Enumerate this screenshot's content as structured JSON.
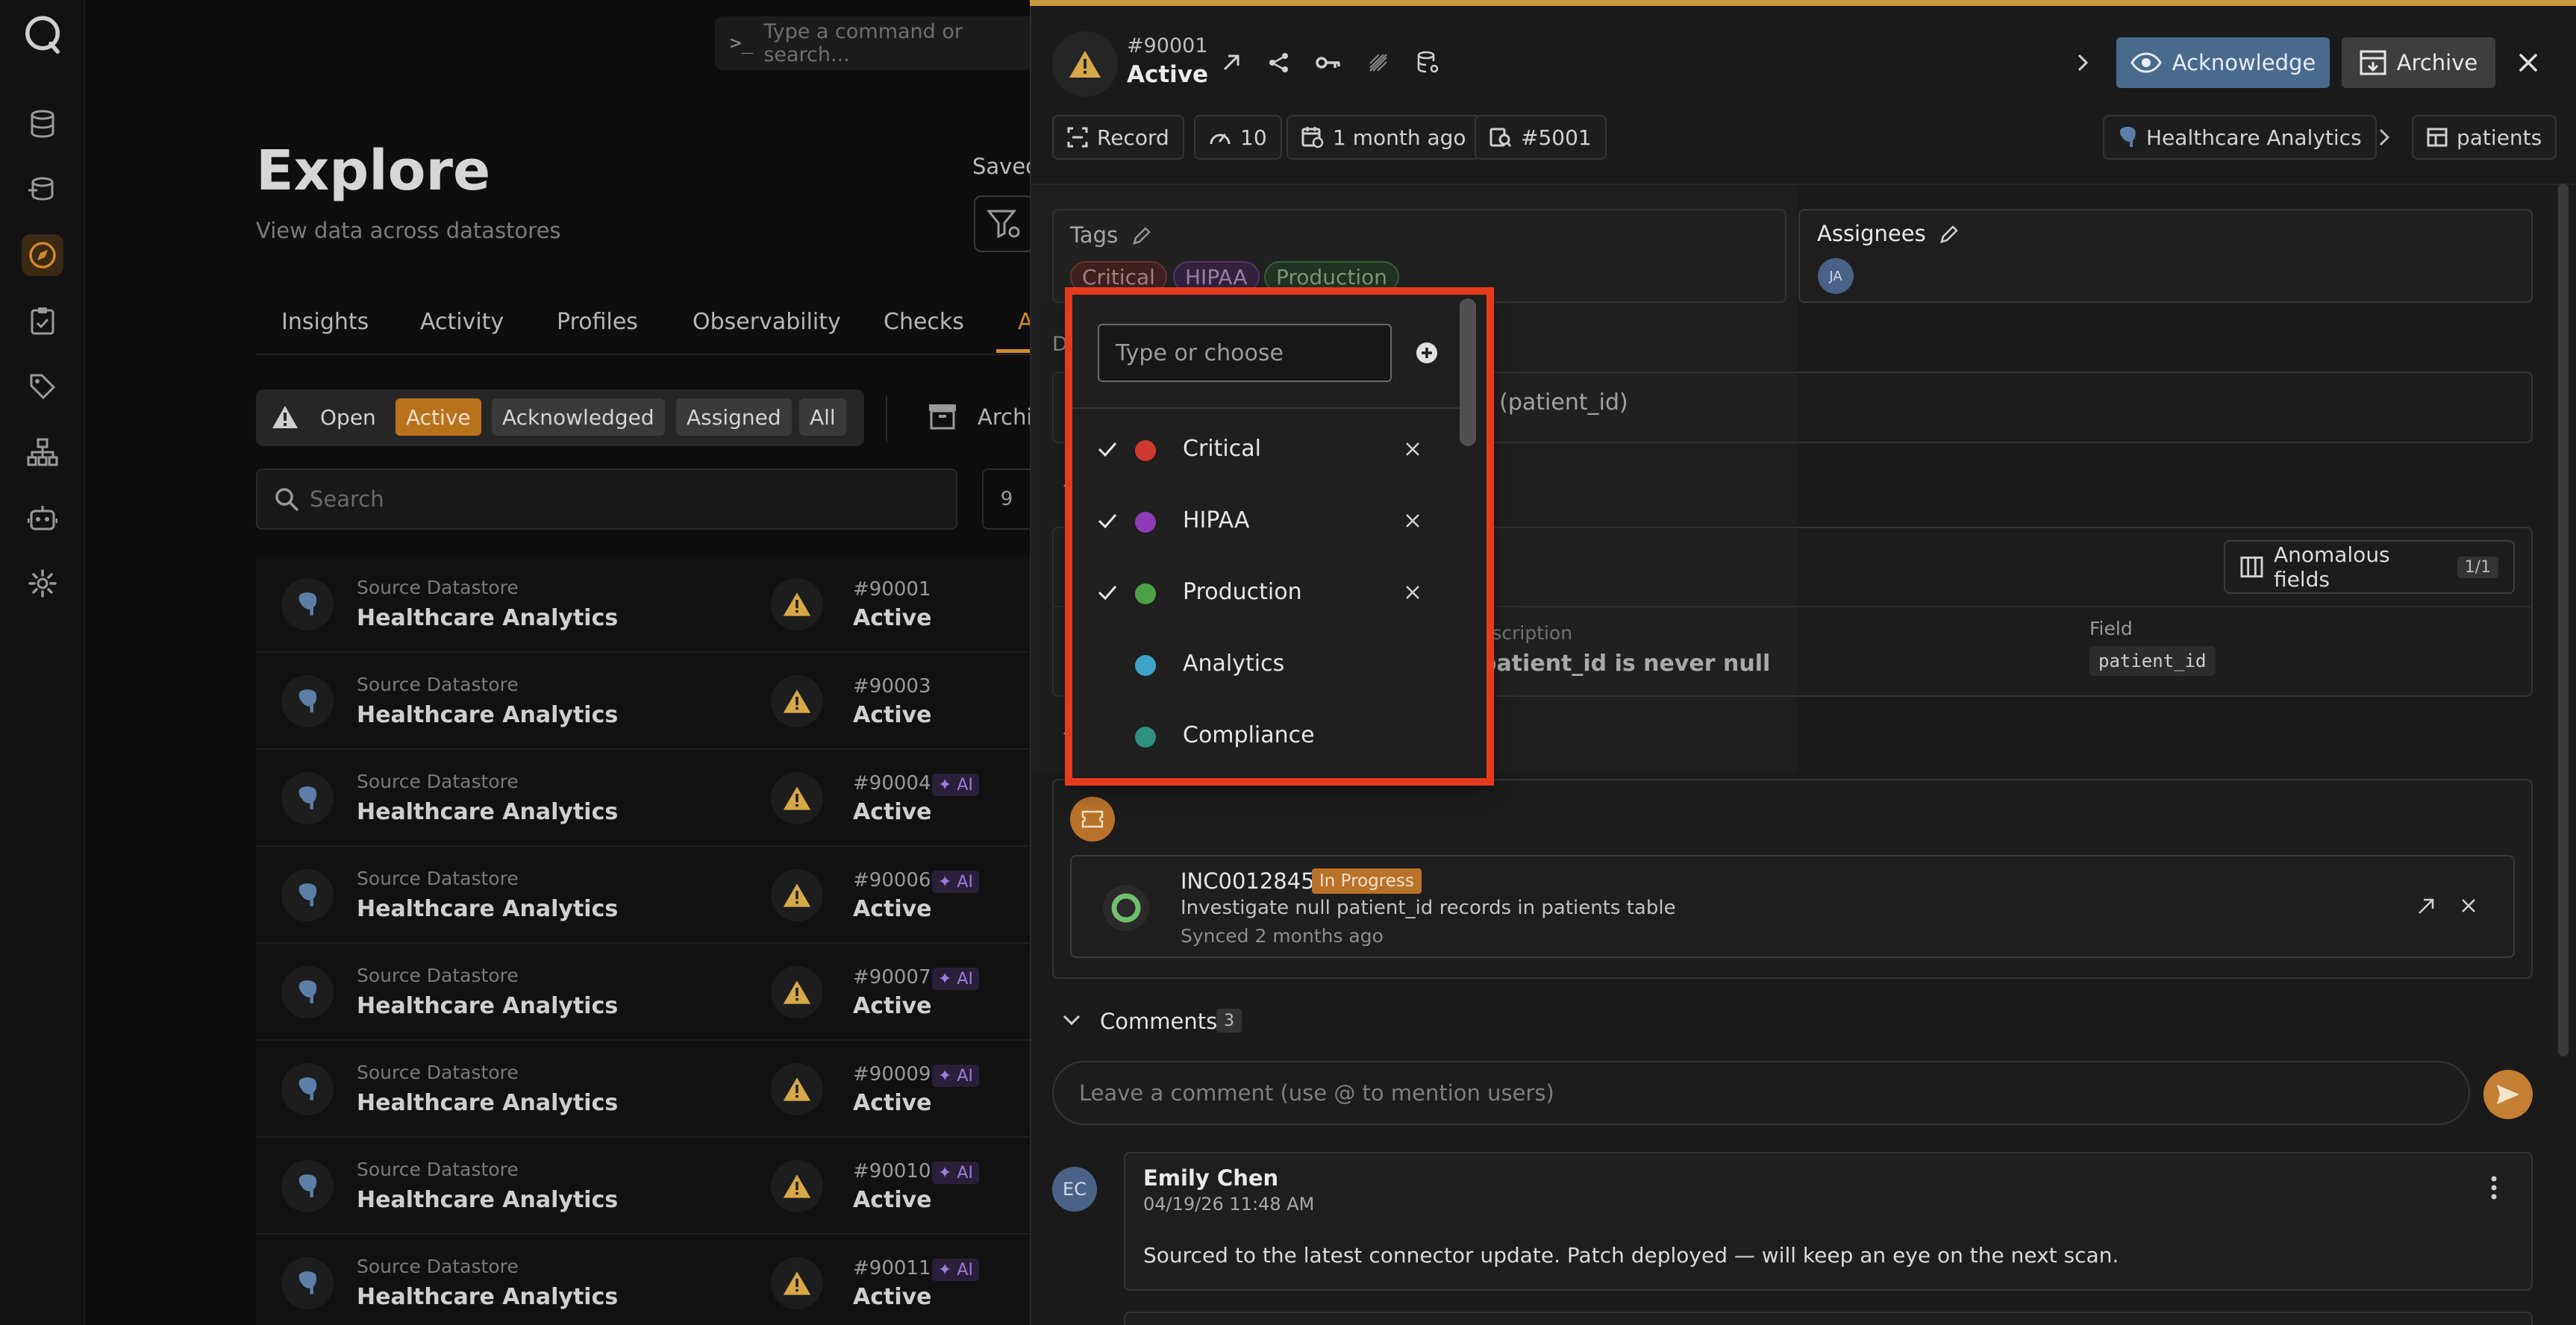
{
  "command_bar": {
    "placeholder": "Type a command or search..."
  },
  "explore": {
    "title": "Explore",
    "subtitle": "View data across datastores",
    "saved_label": "Saved",
    "tabs": [
      "Insights",
      "Activity",
      "Profiles",
      "Observability",
      "Checks",
      "A"
    ],
    "status_filters": [
      "Open",
      "Active",
      "Acknowledged",
      "Assigned",
      "All"
    ],
    "archived_label": "Archi",
    "search_placeholder": "Search",
    "view_toggle": "9",
    "rows": [
      {
        "type": "Source Datastore",
        "name": "Healthcare Analytics",
        "id": "#90001",
        "status": "Active",
        "ai": false
      },
      {
        "type": "Source Datastore",
        "name": "Healthcare Analytics",
        "id": "#90003",
        "status": "Active",
        "ai": false
      },
      {
        "type": "Source Datastore",
        "name": "Healthcare Analytics",
        "id": "#90004",
        "status": "Active",
        "ai": true
      },
      {
        "type": "Source Datastore",
        "name": "Healthcare Analytics",
        "id": "#90006",
        "status": "Active",
        "ai": true
      },
      {
        "type": "Source Datastore",
        "name": "Healthcare Analytics",
        "id": "#90007",
        "status": "Active",
        "ai": true
      },
      {
        "type": "Source Datastore",
        "name": "Healthcare Analytics",
        "id": "#90009",
        "status": "Active",
        "ai": true
      },
      {
        "type": "Source Datastore",
        "name": "Healthcare Analytics",
        "id": "#90010",
        "status": "Active",
        "ai": true
      },
      {
        "type": "Source Datastore",
        "name": "Healthcare Analytics",
        "id": "#90011",
        "status": "Active",
        "ai": true
      }
    ],
    "ai_label": "✦ AI"
  },
  "drawer": {
    "id": "#90001",
    "status": "Active",
    "acknowledge_label": "Acknowledge",
    "archive_label": "Archive",
    "meta": {
      "type": "Record",
      "weight": "10",
      "age": "1 month ago",
      "ref": "#5001",
      "datastore": "Healthcare Analytics",
      "container": "patients"
    },
    "tags_title": "Tags",
    "tags": [
      "Critical",
      "HIPAA",
      "Production"
    ],
    "assignees_title": "Assignees",
    "assignee_initials": "JA",
    "description_label": "D",
    "description_text": "s (patient_id)",
    "anomalous_fields_label": "Anomalous fields",
    "anomalous_fields_count": "1/1",
    "desc_col_label": "escription",
    "desc_col_value": "patient_id is never null",
    "field_col_label": "Field",
    "field_col_value": "patient_id",
    "ticket": {
      "number": "INC0012845",
      "status": "In Progress",
      "description": "Investigate null patient_id records in patients table",
      "synced": "Synced 2 months ago"
    },
    "comments_title": "Comments",
    "comments_count": "3",
    "comment_placeholder": "Leave a comment (use @ to mention users)",
    "comment": {
      "initials": "EC",
      "author": "Emily Chen",
      "date": "04/19/26 11:48 AM",
      "body": "Sourced to the latest connector update. Patch deployed — will keep an eye on the next scan."
    }
  },
  "tag_dropdown": {
    "placeholder": "Type or choose",
    "options": [
      {
        "label": "Critical",
        "color": "#d0392f",
        "selected": true
      },
      {
        "label": "HIPAA",
        "color": "#8e3bb8",
        "selected": true
      },
      {
        "label": "Production",
        "color": "#4ea048",
        "selected": true
      },
      {
        "label": "Analytics",
        "color": "#3ea3c8",
        "selected": false
      },
      {
        "label": "Compliance",
        "color": "#2f8f80",
        "selected": false
      }
    ]
  },
  "colors": {
    "accent": "#d08a2c",
    "acknowledge_bg": "#4a6a8c",
    "highlight_border": "#e63a1e"
  }
}
